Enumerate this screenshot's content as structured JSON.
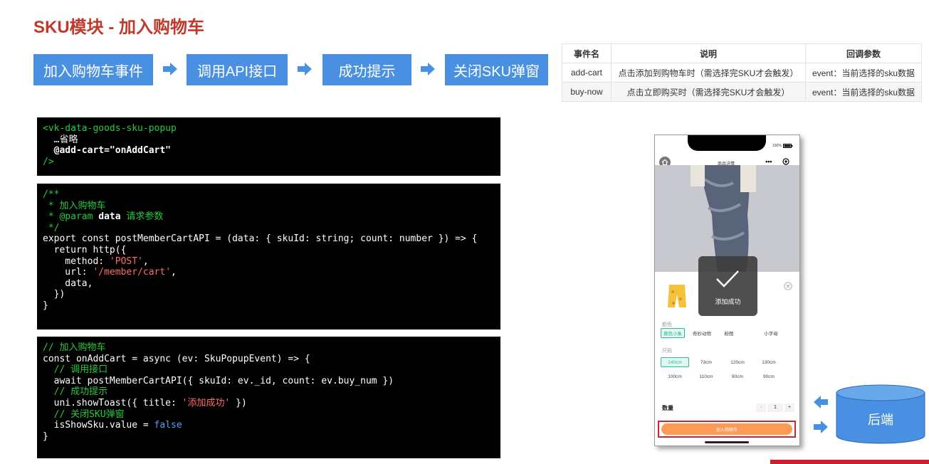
{
  "title": "SKU模块 - 加入购物车",
  "flow": [
    "加入购物车事件",
    "调用API接口",
    "成功提示",
    "关闭SKU弹窗"
  ],
  "events_table": {
    "headers": [
      "事件名",
      "说明",
      "回调参数"
    ],
    "rows": [
      [
        "add-cart",
        "点击添加到购物车时（需选择完SKU才会触发）",
        "event：当前选择的sku数据"
      ],
      [
        "buy-now",
        "点击立即购买时（需选择完SKU才会触发）",
        "event：当前选择的sku数据"
      ]
    ]
  },
  "code1": {
    "l1": "<vk-data-goods-sku-popup",
    "l2": "  …省略",
    "l3": "  @add-cart=\"onAddCart\"",
    "l4": "/>"
  },
  "code2": {
    "l1": "/**",
    "l2": " * 加入购物车",
    "l3_a": " * @param",
    "l3_b": " data",
    "l3_c": " 请求参数",
    "l4": " */",
    "l5": "export const postMemberCartAPI = (data: { skuId: string; count: number }) => {",
    "l6": "  return http({",
    "l7_a": "    method: ",
    "l7_b": "'POST'",
    "l7_c": ",",
    "l8_a": "    url: ",
    "l8_b": "'/member/cart'",
    "l8_c": ",",
    "l9": "    data,",
    "l10": "  })",
    "l11": "}"
  },
  "code3": {
    "l1": "// 加入购物车",
    "l2": "const onAddCart = async (ev: SkuPopupEvent) => {",
    "l3": "  // 调用接口",
    "l4": "  await postMemberCartAPI({ skuId: ev._id, count: ev.buy_num })",
    "l5": "  // 成功提示",
    "l6_a": "  uni.showToast({ title: ",
    "l6_b": "'添加成功'",
    "l6_c": " })",
    "l7": "  // 关闭SKU弹窗",
    "l8_a": "  isShowSku.value = ",
    "l8_b": "false",
    "l9": "}"
  },
  "phone": {
    "battery": "100%",
    "nav_title": "商品详情",
    "toast_text": "添加成功",
    "color_label": "颜色",
    "colors": [
      "黄色小象",
      "奇妙动物",
      "粉图",
      "小字母"
    ],
    "size_label": "尺码",
    "sizes_row1": [
      "140cm",
      "73cm",
      "120cm",
      "130cm"
    ],
    "sizes_row2": [
      "100cm",
      "110cm",
      "80cm",
      "90cm"
    ],
    "qty_label": "数量",
    "qty_minus": "-",
    "qty_value": "1",
    "qty_plus": "+",
    "add_cart_button": "加入购物车"
  },
  "backend_label": "后端",
  "colors": {
    "title": "#c0392b",
    "flow": "#4a90e2",
    "accent": "#27ba9b",
    "cart_button": "#ff9a56",
    "highlight": "#d0262a"
  }
}
